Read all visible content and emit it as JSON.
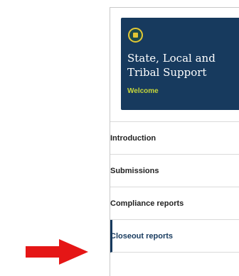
{
  "header": {
    "title": "State, Local and Tribal Support",
    "subtitle": "Welcome",
    "icon": "seal-icon"
  },
  "nav": {
    "items": [
      {
        "label": "Introduction",
        "active": false
      },
      {
        "label": "Submissions",
        "active": false
      },
      {
        "label": "Compliance reports",
        "active": false
      },
      {
        "label": "Closeout reports",
        "active": true
      }
    ]
  },
  "annotation": {
    "icon": "red-arrow-icon",
    "color": "#e51616"
  },
  "colors": {
    "header_background": "#173a5e",
    "header_accent": "#c6d63a",
    "seal_gold": "#e1c735",
    "seal_green": "#1d4b4a",
    "active_text": "#173a5e"
  }
}
